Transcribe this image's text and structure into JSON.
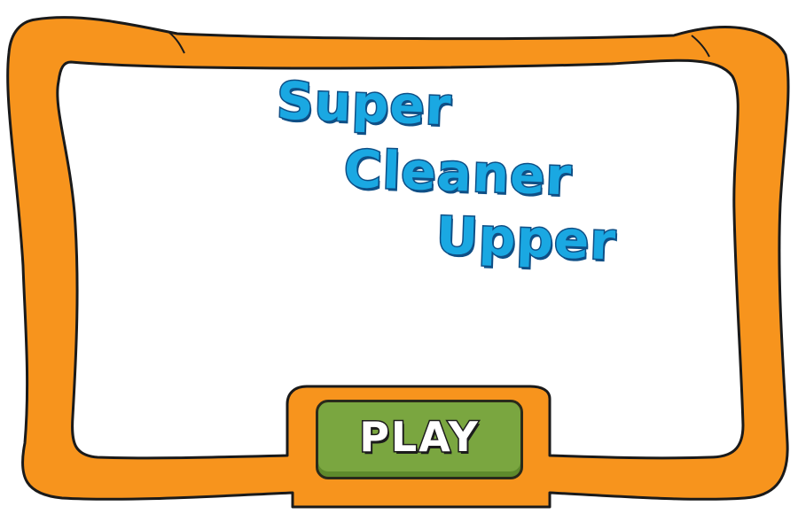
{
  "title": {
    "line1": "Super",
    "line2": "Cleaner",
    "line3": "Upper"
  },
  "play_button": {
    "label": "PLAY"
  },
  "colors": {
    "frame_orange": "#f7941d",
    "frame_outline": "#1a1a1a",
    "title_blue": "#1aa8e2",
    "title_outline": "#0f4f86",
    "button_green": "#7aa640",
    "button_label": "#ffffff"
  }
}
